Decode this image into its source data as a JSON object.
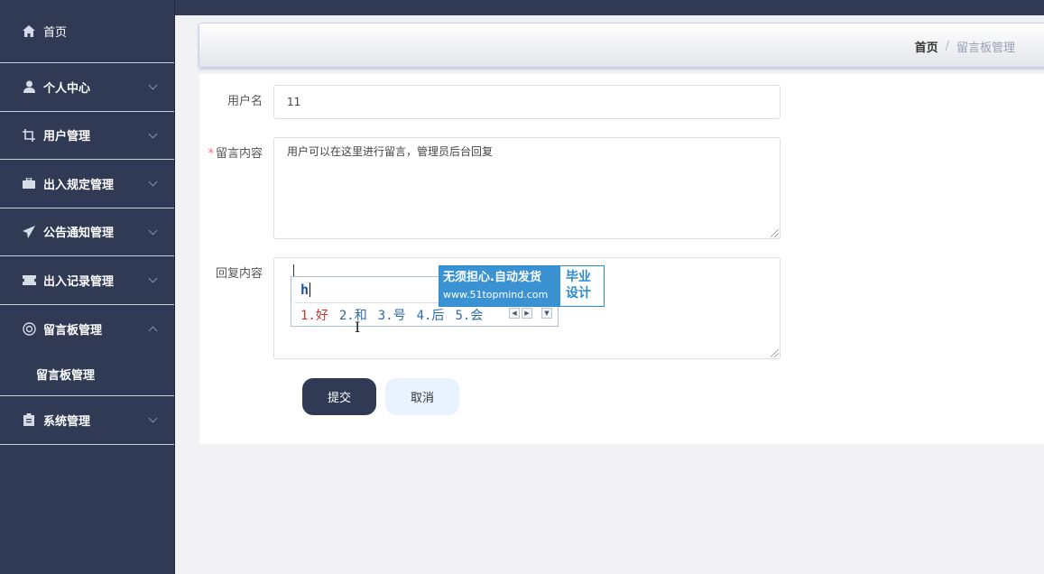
{
  "sidebar": {
    "items": [
      {
        "label": "首页",
        "icon": "home-icon"
      },
      {
        "label": "个人中心",
        "icon": "person-icon"
      },
      {
        "label": "用户管理",
        "icon": "crop-icon"
      },
      {
        "label": "出入规定管理",
        "icon": "briefcase-icon"
      },
      {
        "label": "公告通知管理",
        "icon": "send-icon"
      },
      {
        "label": "出入记录管理",
        "icon": "ticket-icon"
      },
      {
        "label": "留言板管理",
        "icon": "lifebuoy-icon"
      },
      {
        "label": "系统管理",
        "icon": "clipboard-icon"
      }
    ],
    "sub_items": [
      {
        "label": "留言板管理"
      }
    ]
  },
  "breadcrumb": {
    "home": "首页",
    "separator": "/",
    "current": "留言板管理"
  },
  "form": {
    "username_label": "用户名",
    "username_value": "11",
    "message_label": "留言内容",
    "message_required_mark": "*",
    "message_value": "用户可以在这里进行留言，管理员后台回复",
    "reply_label": "回复内容",
    "reply_value": ""
  },
  "buttons": {
    "submit": "提交",
    "cancel": "取消"
  },
  "ime": {
    "composition": "h",
    "candidates": [
      "1.好",
      "2.和",
      "3.号",
      "4.后",
      "5.会"
    ],
    "ad_title": "无须担心.自动发货",
    "ad_url": "www.51topmind.com",
    "ad_side_line1": "毕业",
    "ad_side_line2": "设计"
  },
  "colors": {
    "sidebar_bg": "#303a55",
    "submit_bg": "#303a55",
    "cancel_bg": "#e8f3ff",
    "required": "#f56c6c"
  }
}
